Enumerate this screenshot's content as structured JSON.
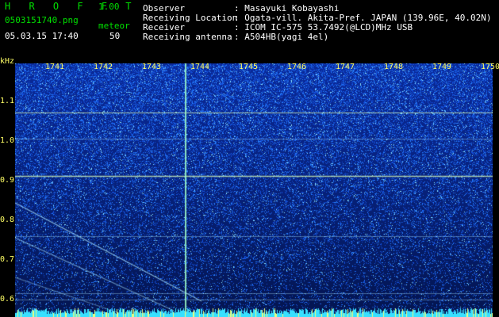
{
  "app": {
    "title": "H R O F F T",
    "version": "1.00",
    "filename": "0503151740.png",
    "mode_label": "meteor",
    "datetime": "05.03.15 17:40",
    "count": "50"
  },
  "info": {
    "observer_label": "Observer",
    "observer_value": ": Masayuki Kobayashi",
    "location_label": "Receiving Location",
    "location_value": ": Ogata-vill. Akita-Pref. JAPAN (139.96E, 40.02N)",
    "receiver_label": "Receiver",
    "receiver_value": ": ICOM IC-575 53.7492(@LCD)MHz USB",
    "antenna_label": "Receiving antenna",
    "antenna_value": ": A504HB(yagi 4el)"
  },
  "axes": {
    "y_unit": "kHz",
    "y_ticks": [
      "1.1",
      "1.0",
      "0.9",
      "0.8",
      "0.7",
      "0.6"
    ],
    "x_ticks": [
      "1741",
      "1742",
      "1743",
      "1744",
      "1745",
      "1746",
      "1747",
      "1748",
      "1749",
      "1750"
    ]
  },
  "colors": {
    "background": "#000000",
    "plot_bg": "#0a1f6e",
    "noise": "#2a6cff",
    "signal": "#9fe8ff",
    "label": "#ffff66",
    "accent": "#00e000"
  }
}
